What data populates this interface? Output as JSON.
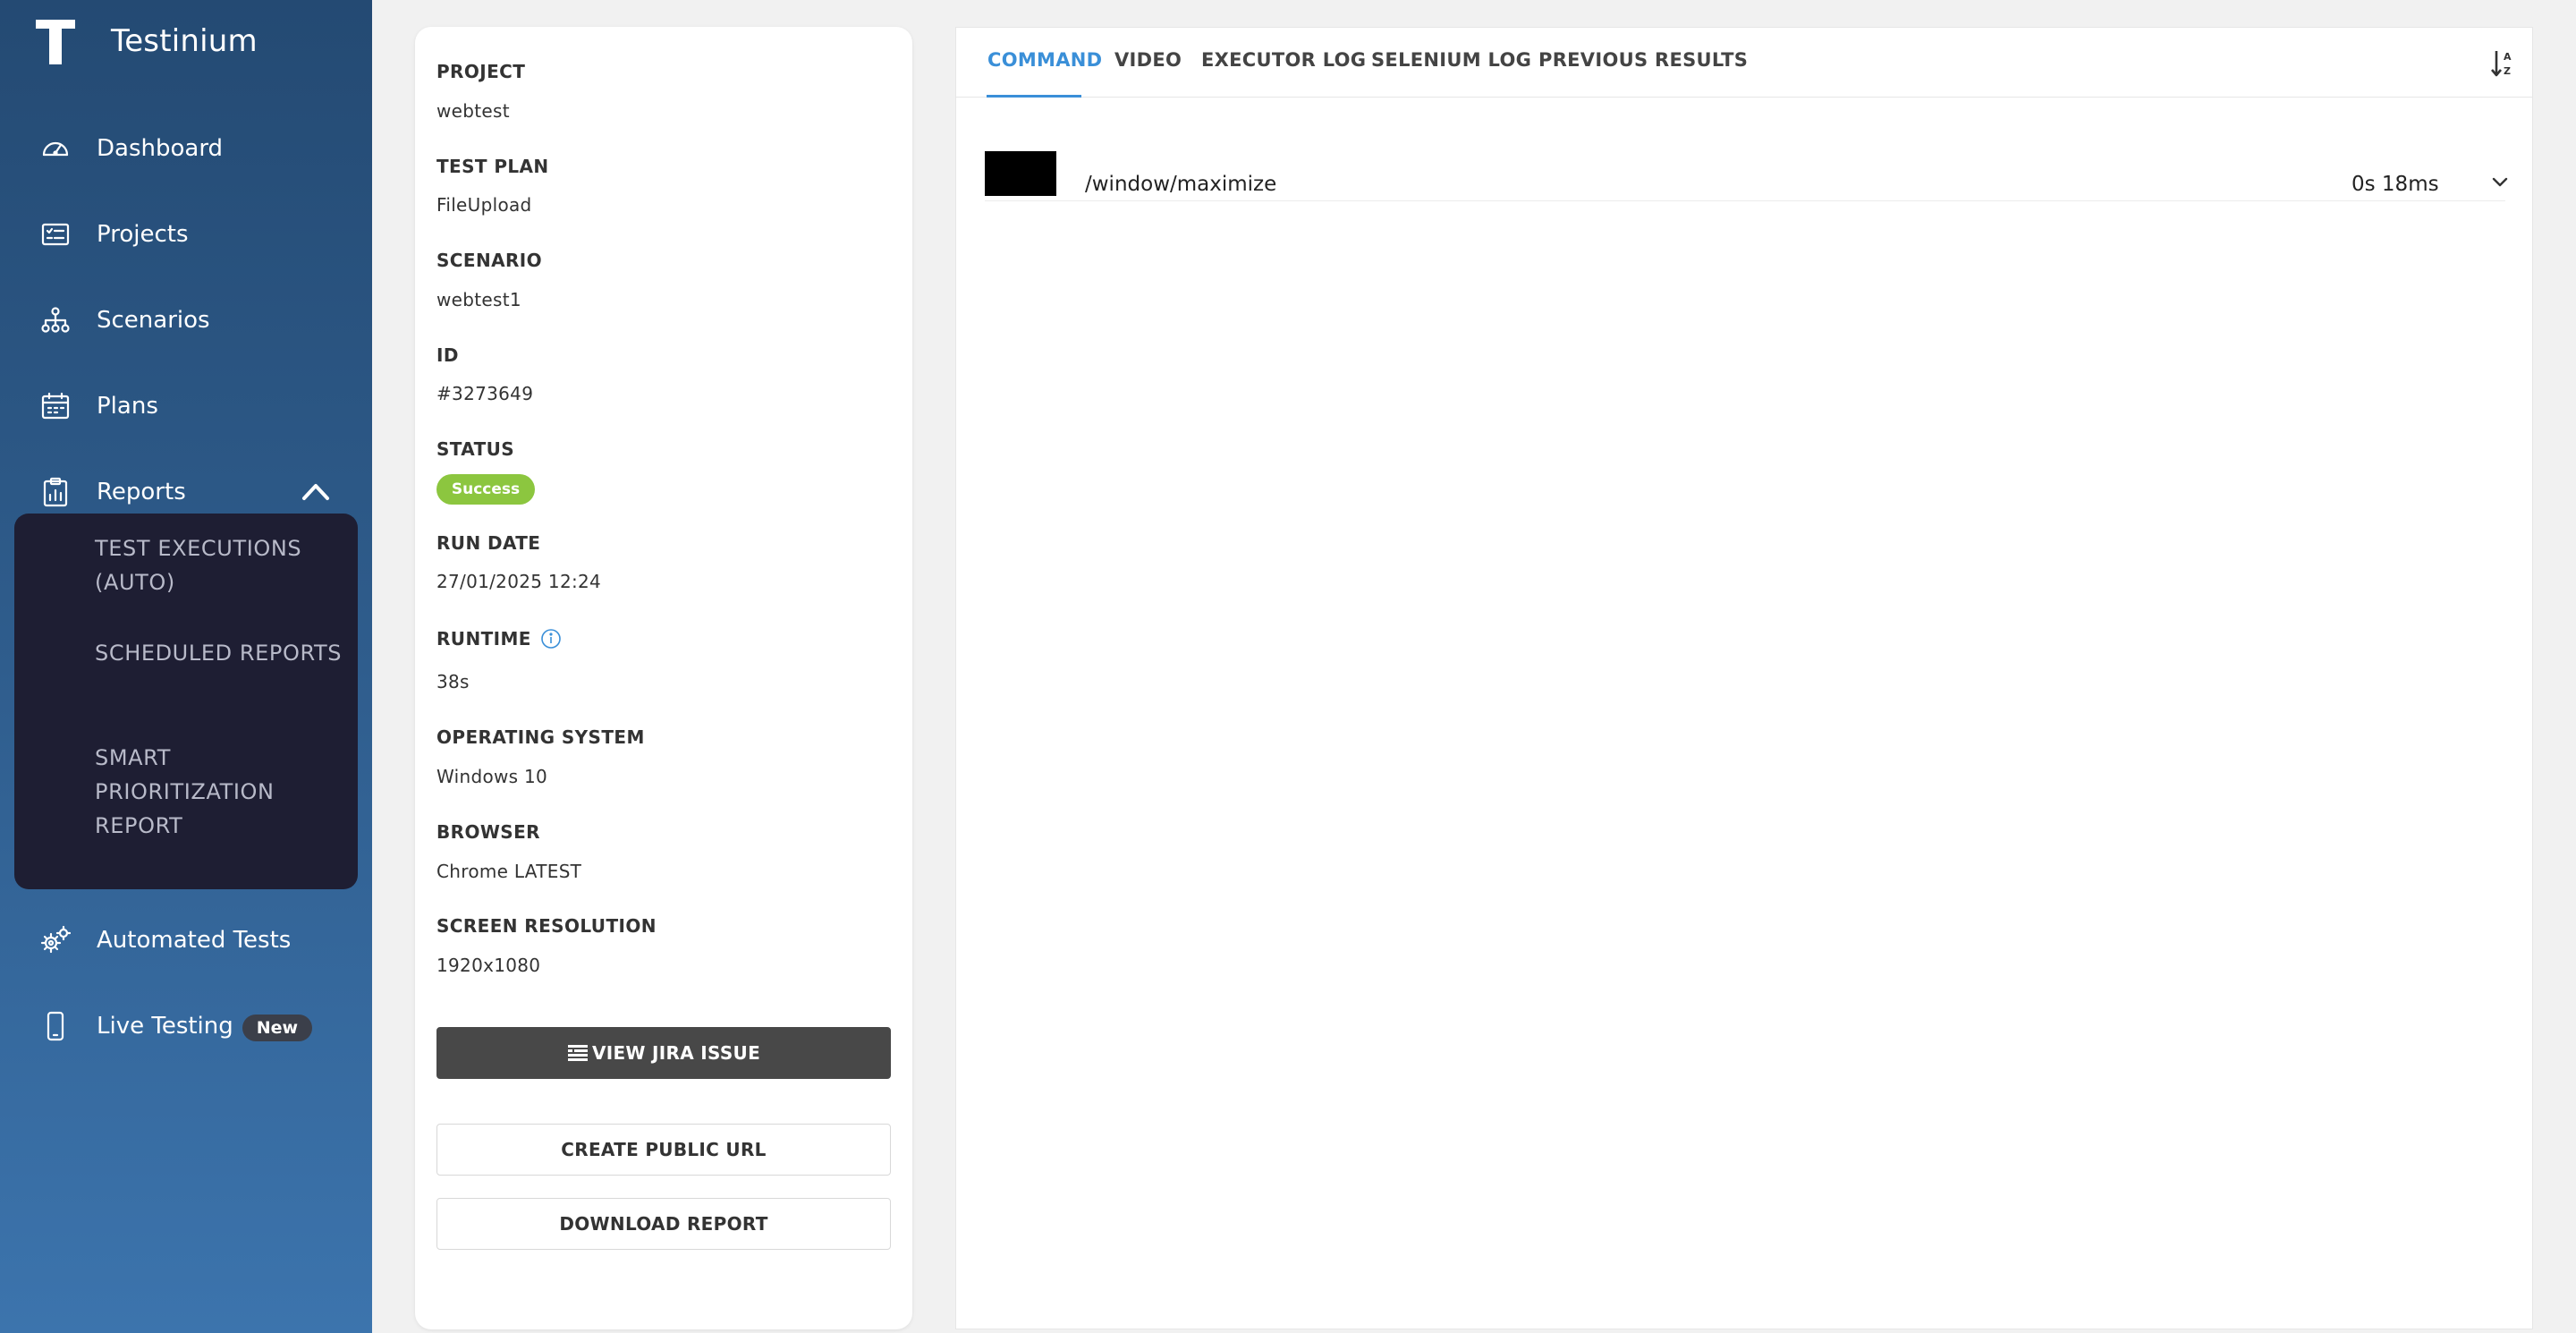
{
  "app": {
    "name": "Testinium"
  },
  "sidebar": {
    "items": [
      {
        "label": "Dashboard",
        "icon": "gauge-icon"
      },
      {
        "label": "Projects",
        "icon": "list-icon"
      },
      {
        "label": "Scenarios",
        "icon": "hierarchy-icon"
      },
      {
        "label": "Plans",
        "icon": "calendar-icon"
      },
      {
        "label": "Reports",
        "icon": "clipboard-icon",
        "expanded": true
      },
      {
        "label": "Automated Tests",
        "icon": "gears-icon"
      },
      {
        "label": "Live Testing",
        "icon": "phone-icon",
        "badge": "New"
      }
    ],
    "reports_submenu": [
      "TEST EXECUTIONS (AUTO)",
      "SCHEDULED REPORTS",
      "SMART PRIORITIZATION REPORT"
    ]
  },
  "details": {
    "fields": [
      {
        "label": "PROJECT",
        "value": "webtest"
      },
      {
        "label": "TEST PLAN",
        "value": "FileUpload"
      },
      {
        "label": "SCENARIO",
        "value": "webtest1"
      },
      {
        "label": "ID",
        "value": "#3273649"
      },
      {
        "label": "STATUS",
        "value": "Success"
      },
      {
        "label": "RUN DATE",
        "value": "27/01/2025 12:24"
      },
      {
        "label": "RUNTIME",
        "value": "38s"
      },
      {
        "label": "OPERATING SYSTEM",
        "value": "Windows 10"
      },
      {
        "label": "BROWSER",
        "value": "Chrome LATEST"
      },
      {
        "label": "SCREEN RESOLUTION",
        "value": "1920x1080"
      }
    ],
    "status_color": "#8cc63f",
    "buttons": {
      "jira": "VIEW JIRA ISSUE",
      "public_url": "CREATE PUBLIC URL",
      "download": "DOWNLOAD REPORT"
    }
  },
  "main": {
    "tabs": [
      "COMMAND",
      "VIDEO",
      "EXECUTOR LOG",
      "SELENIUM LOG",
      "PREVIOUS RESULTS"
    ],
    "active_tab": "COMMAND",
    "accent_color": "#3a8fd8",
    "commands": [
      {
        "text": "/window/maximize",
        "duration": "0s 18ms"
      }
    ]
  }
}
